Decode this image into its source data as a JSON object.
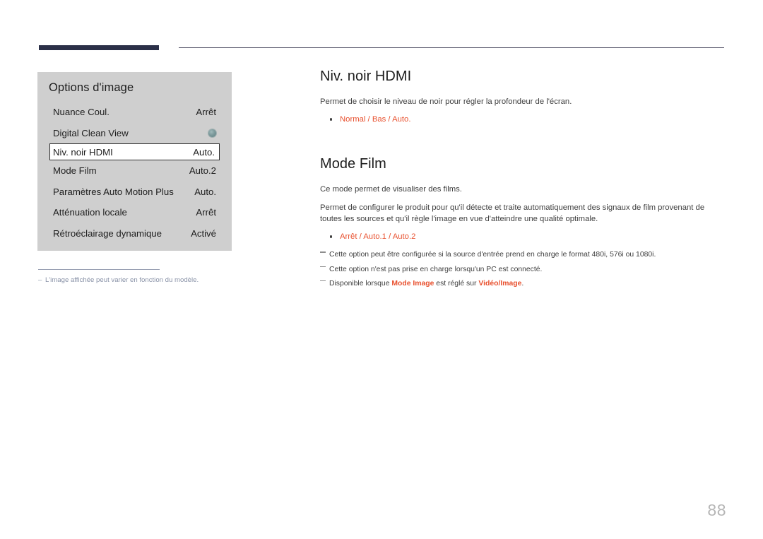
{
  "page": {
    "number": "88"
  },
  "osd": {
    "title": "Options d'image",
    "rows": [
      {
        "label": "Nuance Coul.",
        "value": "Arrêt",
        "type": "text",
        "selected": false
      },
      {
        "label": "Digital Clean View",
        "value": "",
        "type": "indicator",
        "icon": "filled-circle-icon",
        "selected": false
      },
      {
        "label": "Niv. noir HDMI",
        "value": "Auto.",
        "type": "text",
        "selected": true
      },
      {
        "label": "Mode Film",
        "value": "Auto.2",
        "type": "text",
        "selected": false
      },
      {
        "label": "Paramètres Auto Motion Plus",
        "value": "Auto.",
        "type": "text",
        "selected": false
      },
      {
        "label": "Atténuation locale",
        "value": "Arrêt",
        "type": "text",
        "selected": false
      },
      {
        "label": "Rétroéclairage dynamique",
        "value": "Activé",
        "type": "text",
        "selected": false
      }
    ]
  },
  "left_footnote": {
    "dash": "–",
    "text": "L'image affichée peut varier en fonction du modèle."
  },
  "sections": [
    {
      "heading": "Niv. noir HDMI",
      "paragraphs": [
        "Permet de choisir le niveau de noir pour régler la profondeur de l'écran."
      ],
      "options": "Normal / Bas / Auto."
    },
    {
      "heading": "Mode Film",
      "paragraphs": [
        "Ce mode permet de visualiser des films.",
        "Permet de configurer le produit pour qu'il détecte et traite automatiquement des signaux de film provenant de toutes les sources et qu'il règle l'image en vue d'atteindre une qualité optimale."
      ],
      "options": "Arrêt / Auto.1 / Auto.2",
      "notes": [
        {
          "pre": "Cette option peut être configurée si la source d'entrée prend en charge le format 480i, 576i ou 1080i.",
          "bold1": "",
          "mid": "",
          "bold2": "",
          "post": ""
        },
        {
          "pre": "Cette option n'est pas prise en charge lorsqu'un PC est connecté.",
          "bold1": "",
          "mid": "",
          "bold2": "",
          "post": ""
        },
        {
          "pre": "Disponible lorsque ",
          "bold1": "Mode Image",
          "mid": " est réglé sur ",
          "bold2": "Vidéo/Image",
          "post": "."
        }
      ]
    }
  ],
  "colors": {
    "accent": "#e8502e",
    "header_bar": "#2b3048",
    "panel_bg": "#cfcfcf",
    "page_number": "#b6b6b6"
  }
}
